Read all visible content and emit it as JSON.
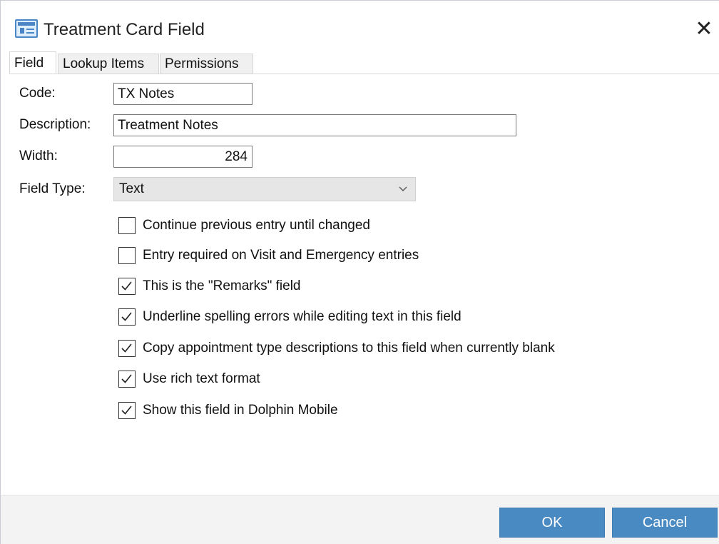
{
  "window": {
    "title": "Treatment Card Field",
    "title_icon": "card-icon",
    "close_glyph": "✕"
  },
  "tabs": [
    {
      "label": "Field",
      "active": true
    },
    {
      "label": "Lookup Items",
      "active": false
    },
    {
      "label": "Permissions",
      "active": false
    }
  ],
  "form": {
    "code": {
      "label": "Code:",
      "value": "TX Notes"
    },
    "description": {
      "label": "Description:",
      "value": "Treatment Notes"
    },
    "width": {
      "label": "Width:",
      "value": "284"
    },
    "field_type": {
      "label": "Field Type:",
      "value": "Text"
    }
  },
  "options": [
    {
      "label": "Continue previous entry until changed",
      "checked": false
    },
    {
      "label": "Entry required on Visit and Emergency entries",
      "checked": false
    },
    {
      "label": "This is the \"Remarks\" field",
      "checked": true
    },
    {
      "label": "Underline spelling errors while editing text in this field",
      "checked": true
    },
    {
      "label": "Copy appointment type descriptions to this field when currently blank",
      "checked": true
    },
    {
      "label": "Use rich text format",
      "checked": true
    },
    {
      "label": "Show this field in Dolphin Mobile",
      "checked": true
    }
  ],
  "buttons": {
    "ok": "OK",
    "cancel": "Cancel"
  },
  "colors": {
    "accent_button": "#4a8ac3",
    "select_bg": "#e6e6e6"
  }
}
